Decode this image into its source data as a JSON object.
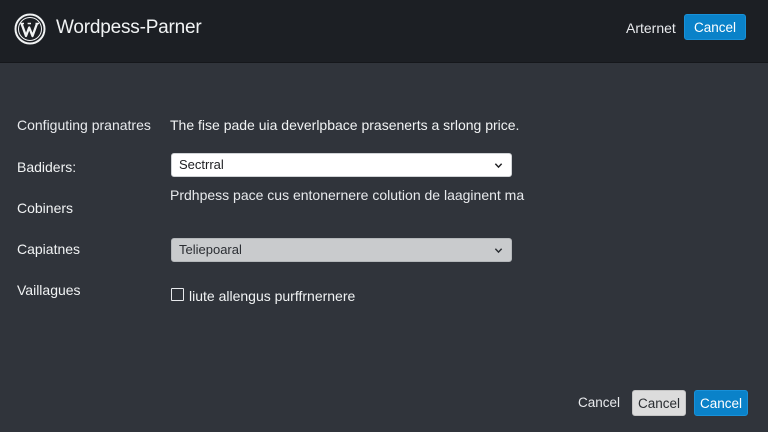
{
  "header": {
    "app_title": "Wordpess-Parner",
    "link_label": "Arternet",
    "cancel_label": "Cancel"
  },
  "form": {
    "section_heading": "Configuting pranatres",
    "description": "The fise pade uia deverlpbace prasenerts a srlong price.",
    "fields": [
      {
        "label": "Badiders:",
        "select_value": "Sectrral"
      },
      {
        "label": "Cobiners",
        "helper_text": "Prdhpess pace cus entonernere colution de laaginent ma"
      },
      {
        "label": "Capiatnes",
        "select_value": "Teliepoaral"
      },
      {
        "label": "Vaillagues",
        "checkbox_label": "liute allengus purffrnernere",
        "checked": false
      }
    ]
  },
  "footer": {
    "cancel_link_label": "Cancel",
    "cancel_secondary_label": "Cancel",
    "cancel_primary_label": "Cancel"
  },
  "icons": {
    "logo": "wordpress-logo-icon",
    "dropdown": "chevron-down-icon"
  },
  "colors": {
    "background": "#30343b",
    "header": "#1c1f24",
    "accent": "#0a82c9"
  }
}
